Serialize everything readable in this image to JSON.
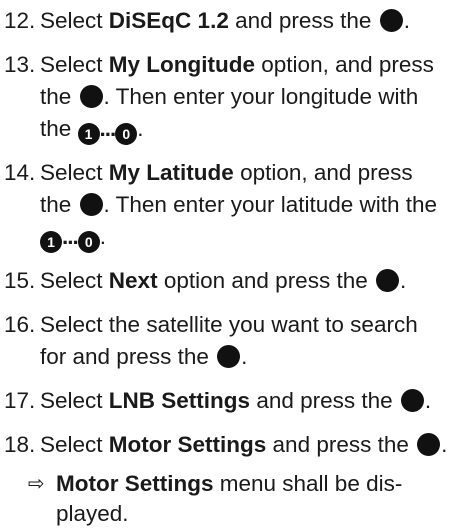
{
  "steps": [
    {
      "num": "12.",
      "pre": "Select ",
      "bold": "DiSEqC 1.2",
      "post": " and press the "
    },
    {
      "num": "13.",
      "pre": "Select ",
      "bold": "My Longitude",
      "post": " option, and press",
      "line2_pre": "the ",
      "line2_post": ". Then enter your longitude with",
      "line3_pre": "the ",
      "key_start": "1",
      "key_mid": "...",
      "key_end": "0"
    },
    {
      "num": "14.",
      "pre": "Select ",
      "bold": "My Latitude",
      "post": " option, and press",
      "line2_pre": "the ",
      "line2_post": ". Then enter your latitude with the",
      "key_start": "1",
      "key_mid": "...",
      "key_end": "0"
    },
    {
      "num": "15.",
      "pre": "Select ",
      "bold": "Next",
      "post": " option and press the "
    },
    {
      "num": "16.",
      "pre": "Select the satellite you want to search",
      "line2_pre": "for and press the "
    },
    {
      "num": "17.",
      "pre": "Select ",
      "bold": "LNB Settings",
      "post": " and press the "
    },
    {
      "num": "18.",
      "pre": "Select ",
      "bold": "Motor Settings",
      "post": " and press the "
    }
  ],
  "result": {
    "arrow": "⇨",
    "bold": "Motor Settings",
    "text": " menu shall be dis-",
    "text2": "played."
  },
  "icons": {
    "ok_button": "ok-button-icon",
    "number_key": "number-key-icon"
  },
  "colors": {
    "text": "#1a1a1a",
    "icon": "#111111"
  }
}
